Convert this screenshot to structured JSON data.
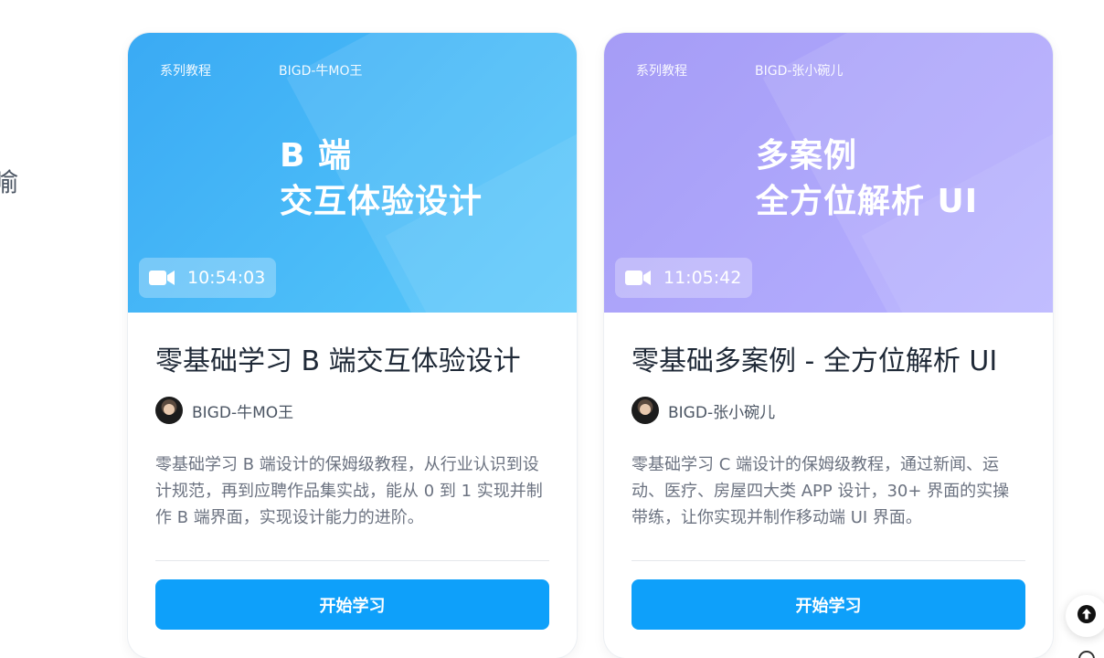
{
  "left_fragment": "喻",
  "cards": [
    {
      "cover": {
        "series_tag": "系列教程",
        "author_tag": "BIGD-牛MO王",
        "title_line1": "B 端",
        "title_line2": "交互体验设计",
        "duration": "10:54:03",
        "gradient_from": "#3aaaf4",
        "gradient_to": "#56c8fb"
      },
      "title": "零基础学习 B 端交互体验设计",
      "author": "BIGD-牛MO王",
      "description": "零基础学习 B 端设计的保姆级教程，从行业认识到设计规范，再到应聘作品集实战，能从 0 到 1 实现并制作 B 端界面，实现设计能力的进阶。",
      "cta_label": "开始学习"
    },
    {
      "cover": {
        "series_tag": "系列教程",
        "author_tag": "BIGD-张小碗儿",
        "title_line1": "多案例",
        "title_line2": "全方位解析 UI",
        "duration": "11:05:42",
        "gradient_from": "#a59cf6",
        "gradient_to": "#b6b0ff"
      },
      "title": "零基础多案例 - 全方位解析 UI",
      "author": "BIGD-张小碗儿",
      "description": "零基础学习 C 端设计的保姆级教程，通过新闻、运动、医疗、房屋四大类 APP 设计，30+ 界面的实操带练，让你实现并制作移动端 UI 界面。",
      "cta_label": "开始学习"
    }
  ],
  "icons": {
    "duration": "video-camera-icon",
    "back_to_top": "arrow-up-icon"
  },
  "colors": {
    "cta": "#0ea0fa",
    "title_text": "#1f2937",
    "body_text": "#6b7280"
  }
}
